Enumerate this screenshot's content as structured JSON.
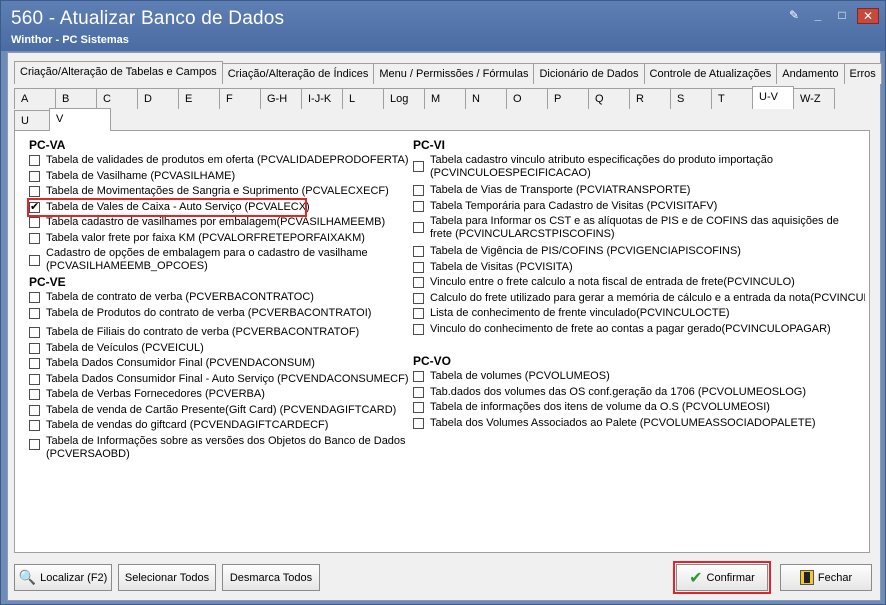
{
  "window": {
    "title": "560 - Atualizar Banco de Dados",
    "subtitle": "Winthor - PC Sistemas"
  },
  "tabs_main": [
    "Criação/Alteração de Tabelas e Campos",
    "Criação/Alteração de Índices",
    "Menu / Permissões / Fórmulas",
    "Dicionário de Dados",
    "Controle de Atualizações",
    "Andamento",
    "Erros"
  ],
  "tabs_letters": [
    "A",
    "B",
    "C",
    "D",
    "E",
    "F",
    "G-H",
    "I-J-K",
    "L",
    "Log",
    "M",
    "N",
    "O",
    "P",
    "Q",
    "R",
    "S",
    "T",
    "U-V",
    "W-Z"
  ],
  "tabs_sub": [
    "U",
    "V"
  ],
  "groups": {
    "pcva": {
      "title": "PC-VA",
      "items": [
        "Tabela de validades de produtos em oferta (PCVALIDADEPRODOFERTA)",
        "Tabela de Vasilhame (PCVASILHAME)",
        "Tabela de Movimentações de Sangria e Suprimento (PCVALECXECF)",
        "Tabela de Vales de Caixa - Auto Serviço (PCVALECX)",
        "Tabela cadastro de vasilhames por embalagem(PCVASILHAMEEMB)",
        "Tabela valor frete por faixa KM (PCVALORFRETEPORFAIXAKM)",
        "Cadastro de opções de embalagem para o cadastro de vasilhame (PCVASILHAMEEMB_OPCOES)"
      ]
    },
    "pcve": {
      "title": "PC-VE",
      "items": [
        "Tabela de contrato de verba (PCVERBACONTRATOC)",
        "Tabela de Produtos do contrato de verba (PCVERBACONTRATOI)",
        "Tabela de Filiais do contrato de verba (PCVERBACONTRATOF)",
        "Tabela de Veículos (PCVEICUL)",
        "Tabela Dados Consumidor Final  (PCVENDACONSUM)",
        "Tabela Dados Consumidor Final - Auto Serviço (PCVENDACONSUMECF)",
        "Tabela de Verbas Fornecedores (PCVERBA)",
        "Tabela de venda de Cartão Presente(Gift Card) (PCVENDAGIFTCARD)",
        "Tabela de vendas do giftcard (PCVENDAGIFTCARDECF)",
        "Tabela de Informações sobre as versões dos Objetos do Banco de Dados (PCVERSAOBD)"
      ]
    },
    "pcvi": {
      "title": "PC-VI",
      "items": [
        "Tabela cadastro vinculo atributo especificações do produto importação (PCVINCULOESPECIFICACAO)",
        "Tabela de Vias de Transporte (PCVIATRANSPORTE)",
        "Tabela Temporária para Cadastro de Visitas (PCVISITAFV)",
        "Tabela para Informar os CST e as alíquotas de PIS e de COFINS das aquisições de frete (PCVINCULARCSTPISCOFINS)",
        "Tabela de Vigência de PIS/COFINS (PCVIGENCIAPISCOFINS)",
        "Tabela  de Visitas (PCVISITA)",
        "Vinculo entre o frete calculo a nota fiscal de entrada de frete(PCVINCULO)",
        "Calculo do frete utilizado para gerar a memória de cálculo e a entrada da nota(PCVINCULO",
        "Lista de conhecimento de frente vinculado(PCVINCULOCTE)",
        "Vinculo do conhecimento de frete ao contas a pagar gerado(PCVINCULOPAGAR)"
      ]
    },
    "pcvo": {
      "title": "PC-VO",
      "items": [
        "Tabela de volumes (PCVOLUMEOS)",
        "Tab.dados dos volumes das OS conf.geração da 1706 (PCVOLUMEOSLOG)",
        "Tabela de informações dos itens de volume da O.S (PCVOLUMEOSI)",
        "Tabela dos Volumes Associados ao Palete (PCVOLUMEASSOCIADOPALETE)"
      ]
    }
  },
  "buttons": {
    "localizar": "Localizar (F2)",
    "selecionar": "Selecionar Todos",
    "desmarca": "Desmarca Todos",
    "confirmar": "Confirmar",
    "fechar": "Fechar"
  }
}
